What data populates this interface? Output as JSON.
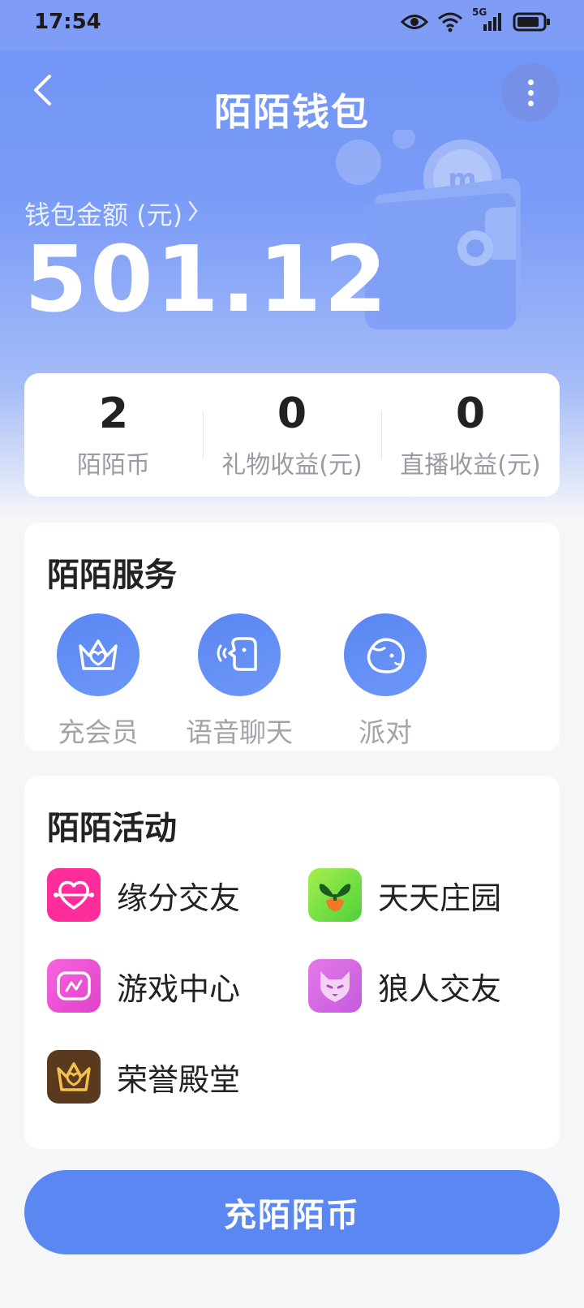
{
  "status_bar": {
    "time": "17:54",
    "network": "5G",
    "icons": [
      "eye-icon",
      "wifi-icon",
      "signal-icon",
      "battery-icon"
    ]
  },
  "header": {
    "title": "陌陌钱包",
    "back_icon": "chevron-left-icon",
    "more_icon": "more-vertical-icon"
  },
  "balance": {
    "label": "钱包金额 (元)",
    "value": "501.12"
  },
  "stats": [
    {
      "value": "2",
      "label": "陌陌币"
    },
    {
      "value": "0",
      "label": "礼物收益(元)"
    },
    {
      "value": "0",
      "label": "直播收益(元)"
    }
  ],
  "services": {
    "title": "陌陌服务",
    "items": [
      {
        "label": "充会员",
        "icon": "crown-icon"
      },
      {
        "label": "语音聊天",
        "icon": "voice-chat-icon"
      },
      {
        "label": "派对",
        "icon": "party-face-icon"
      }
    ]
  },
  "activities": {
    "title": "陌陌活动",
    "items": [
      {
        "label": "缘分交友",
        "icon": "heart-icon",
        "color": "#ff2d9c"
      },
      {
        "label": "天天庄园",
        "icon": "sprout-icon",
        "color": "#6fe03a"
      },
      {
        "label": "游戏中心",
        "icon": "gamepad-icon",
        "color": "#f25ad6"
      },
      {
        "label": "狼人交友",
        "icon": "wolf-icon",
        "color": "#d865e6"
      },
      {
        "label": "荣誉殿堂",
        "icon": "crown-icon",
        "color": "#5a3a1e"
      }
    ]
  },
  "recharge_button": {
    "label": "充陌陌币"
  },
  "colors": {
    "accent": "#5b87f3",
    "hero_top": "#6f93f5"
  }
}
